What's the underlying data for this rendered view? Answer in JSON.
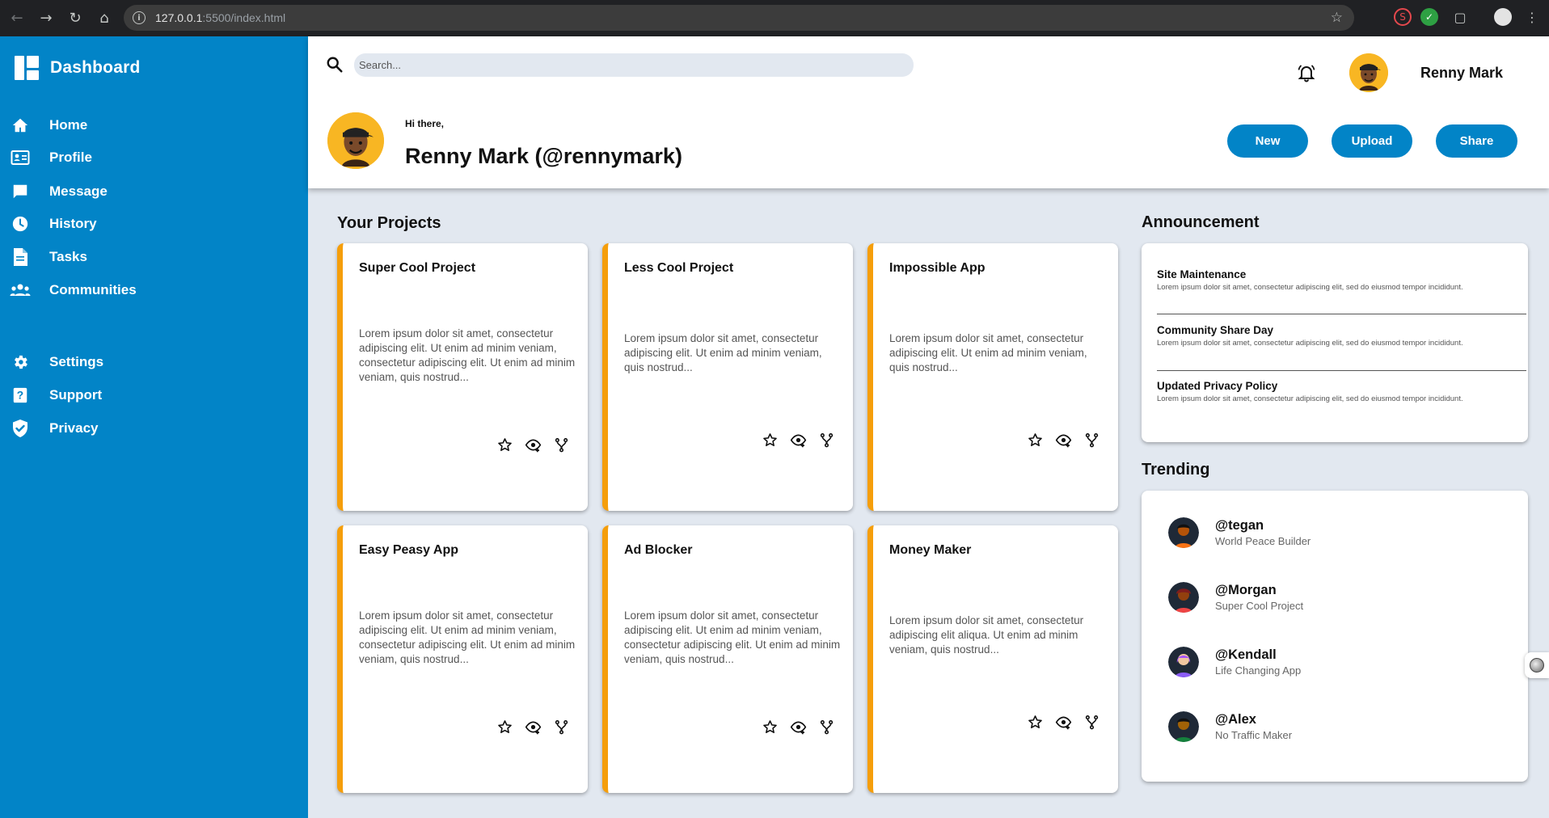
{
  "browser": {
    "url_host": "127.0.0.1",
    "url_rest": ":5500/index.html"
  },
  "sidebar": {
    "brand": "Dashboard",
    "items": [
      {
        "label": "Home",
        "icon": "home-icon"
      },
      {
        "label": "Profile",
        "icon": "id-card-icon"
      },
      {
        "label": "Message",
        "icon": "chat-icon"
      },
      {
        "label": "History",
        "icon": "clock-icon"
      },
      {
        "label": "Tasks",
        "icon": "document-icon"
      },
      {
        "label": "Communities",
        "icon": "users-icon"
      }
    ],
    "bottom_items": [
      {
        "label": "Settings",
        "icon": "gear-icon"
      },
      {
        "label": "Support",
        "icon": "question-icon"
      },
      {
        "label": "Privacy",
        "icon": "shield-icon"
      }
    ]
  },
  "header": {
    "search_placeholder": "Search...",
    "user_name": "Renny Mark",
    "greeting": "Hi there,",
    "full_name": "Renny Mark (@rennymark)",
    "buttons": [
      "New",
      "Upload",
      "Share"
    ]
  },
  "projects": {
    "title": "Your Projects",
    "items": [
      {
        "title": "Super Cool Project",
        "desc": "Lorem ipsum dolor sit amet, consectetur adipiscing elit. Ut enim ad minim veniam, consectetur adipiscing elit. Ut enim ad minim veniam, quis nostrud..."
      },
      {
        "title": "Less Cool Project",
        "desc": "Lorem ipsum dolor sit amet, consectetur adipiscing elit. Ut enim ad minim veniam, quis nostrud..."
      },
      {
        "title": "Impossible App",
        "desc": "Lorem ipsum dolor sit amet, consectetur adipiscing elit. Ut enim ad minim veniam, quis nostrud..."
      },
      {
        "title": "Easy Peasy App",
        "desc": "Lorem ipsum dolor sit amet, consectetur adipiscing elit. Ut enim ad minim veniam, consectetur adipiscing elit. Ut enim ad minim veniam, quis nostrud..."
      },
      {
        "title": "Ad Blocker",
        "desc": "Lorem ipsum dolor sit amet, consectetur adipiscing elit. Ut enim ad minim veniam, consectetur adipiscing elit. Ut enim ad minim veniam, quis nostrud..."
      },
      {
        "title": "Money Maker",
        "desc": "Lorem ipsum dolor sit amet, consectetur adipiscing elit aliqua. Ut enim ad minim veniam, quis nostrud..."
      }
    ]
  },
  "announcements": {
    "title": "Announcement",
    "items": [
      {
        "title": "Site Maintenance",
        "desc": "Lorem ipsum dolor sit amet, consectetur adipiscing elit, sed do eiusmod tempor incididunt."
      },
      {
        "title": "Community Share Day",
        "desc": "Lorem ipsum dolor sit amet, consectetur adipiscing elit, sed do eiusmod tempor incididunt."
      },
      {
        "title": "Updated Privacy Policy",
        "desc": "Lorem ipsum dolor sit amet, consectetur adipiscing elit, sed do eiusmod tempor incididunt."
      }
    ]
  },
  "trending": {
    "title": "Trending",
    "items": [
      {
        "handle": "@tegan",
        "subtitle": "World Peace Builder"
      },
      {
        "handle": "@Morgan",
        "subtitle": "Super Cool Project"
      },
      {
        "handle": "@Kendall",
        "subtitle": "Life Changing App"
      },
      {
        "handle": "@Alex",
        "subtitle": "No Traffic Maker"
      }
    ]
  },
  "colors": {
    "accent": "#0284c7",
    "card_border": "#f59e0b",
    "page_bg": "#e2e8f0",
    "avatar_bg": "#f8b623"
  }
}
